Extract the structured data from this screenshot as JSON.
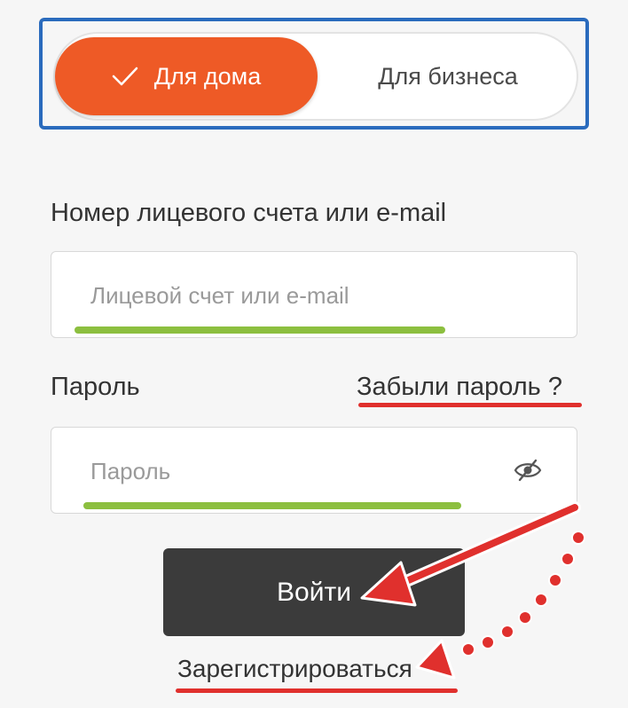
{
  "account_type_toggle": {
    "home_label": "Для дома",
    "business_label": "Для бизнеса",
    "selected": "Для дома"
  },
  "login_form": {
    "account_label": "Номер лицевого счета или e-mail",
    "account_placeholder": "Лицевой счет или e-mail",
    "password_label": "Пароль",
    "password_placeholder": "Пароль",
    "forgot_password_link": "Забыли пароль ?",
    "submit_button": "Войти",
    "register_link": "Зарегистрироваться"
  },
  "icons": {
    "toggle_check": "check-icon",
    "password_visibility": "eye-off-icon"
  },
  "colors": {
    "accent": "#ee5a26",
    "highlight_frame": "#2a6bbd",
    "button_bg": "#3b3b3b",
    "annotation_green": "#8cbf3f",
    "annotation_red": "#e0302d"
  }
}
